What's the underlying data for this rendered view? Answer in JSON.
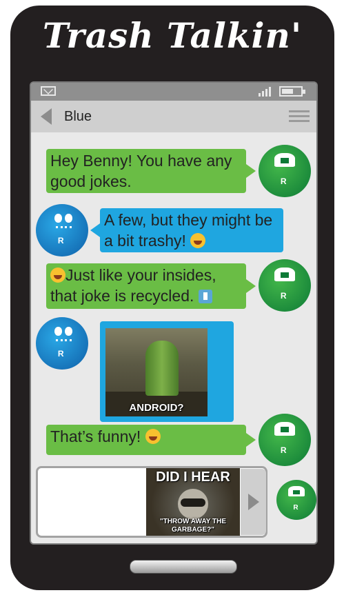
{
  "app_title": "Trash Talkin'",
  "header": {
    "contact_name": "Blue"
  },
  "icons": {
    "status_left": "mail-icon",
    "status_signal": "signal-bars-icon",
    "status_battery": "battery-icon",
    "back": "back-arrow-icon",
    "menu": "hamburger-menu-icon",
    "send": "send-arrow-icon"
  },
  "messages": [
    {
      "sender": "green",
      "text": "Hey Benny! You have any good jokes."
    },
    {
      "sender": "blue",
      "text": "A few, but they might be a bit trashy!",
      "emoji": "laughing-tears"
    },
    {
      "sender": "green",
      "emoji_before": "sleeping-face",
      "text": "Just like your insides, that joke is recycled.",
      "emoji": "trash-bin-sign"
    },
    {
      "sender": "blue",
      "type": "image",
      "caption": "ANDROID?"
    },
    {
      "sender": "green",
      "text": "That’s funny!",
      "emoji": "grinning-face"
    }
  ],
  "compose": {
    "meme_line1": "DID I HEAR",
    "meme_line2": "\"THROW AWAY THE GARBAGE?\""
  },
  "avatar_logo": "R",
  "colors": {
    "green": "#6abd45",
    "blue": "#1fa6e0",
    "phone": "#231f20"
  }
}
